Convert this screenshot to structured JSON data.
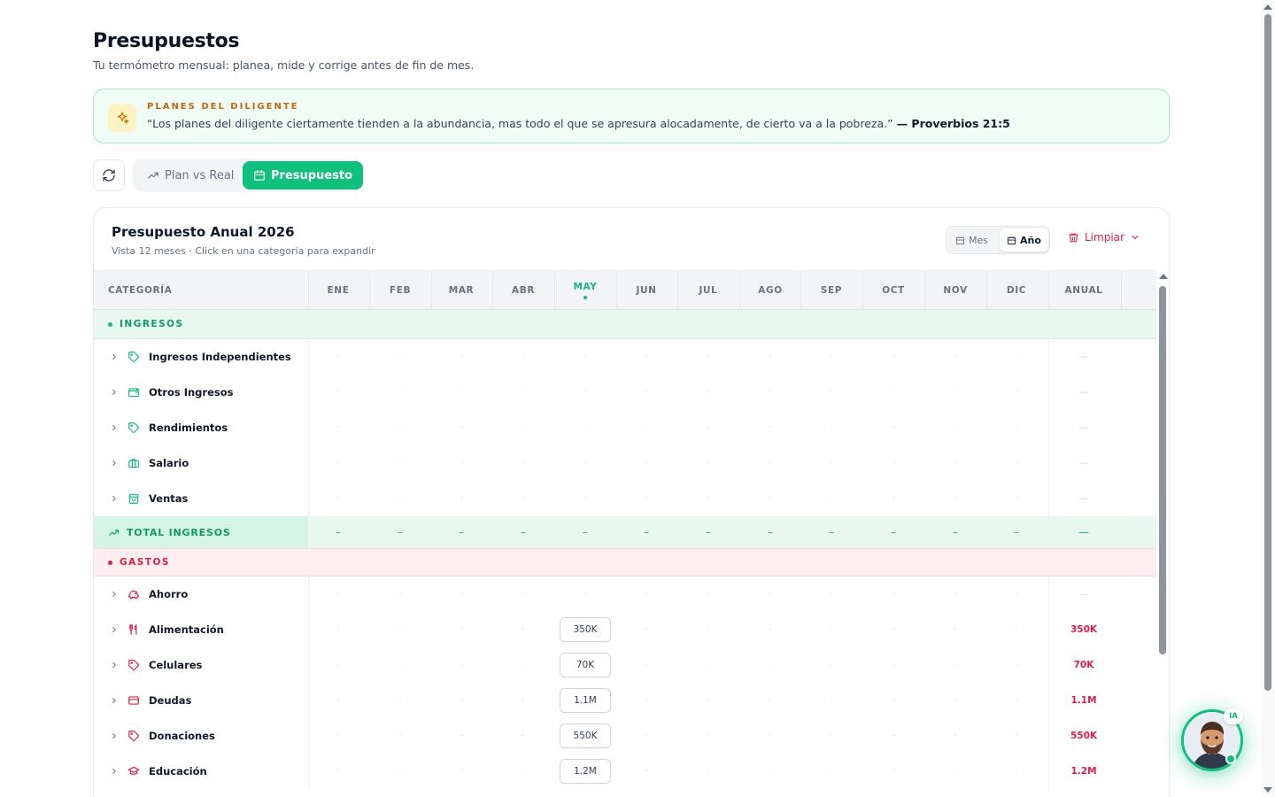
{
  "header": {
    "title": "Presupuestos",
    "subtitle": "Tu termómetro mensual: planea, mide y corrige antes de fin de mes."
  },
  "quote": {
    "heading": "PLANES DEL DILIGENTE",
    "text": "“Los planes del diligente ciertamente tienden a la abundancia, mas todo el que se apresura alocadamente, de cierto va a la pobreza.”",
    "reference": "— Proverbios 21:5",
    "icon": "sparkles-icon"
  },
  "toolbar": {
    "refresh_icon": "refresh-icon",
    "views": [
      {
        "label": "Plan vs Real",
        "icon": "trending-up-icon",
        "active": false
      },
      {
        "label": "Presupuesto",
        "icon": "calendar-icon",
        "active": true
      }
    ]
  },
  "panel": {
    "title": "Presupuesto Anual 2026",
    "subtitle": "Vista 12 meses · Click en una categoría para expandir",
    "range": {
      "mes_label": "Mes",
      "ano_label": "Año",
      "selected": "Año"
    },
    "clear_label": "Limpiar"
  },
  "table": {
    "category_header": "CATEGORÍA",
    "months": [
      "ENE",
      "FEB",
      "MAR",
      "ABR",
      "MAY",
      "JUN",
      "JUL",
      "AGO",
      "SEP",
      "OCT",
      "NOV",
      "DIC"
    ],
    "current_month": "MAY",
    "annual_header": "ANUAL",
    "empty_cell": "·",
    "empty_annual": "—",
    "income_section": "INGRESOS",
    "income_rows": [
      {
        "name": "Ingresos Independientes",
        "icon": "tag-icon"
      },
      {
        "name": "Otros Ingresos",
        "icon": "wallet-icon"
      },
      {
        "name": "Rendimientos",
        "icon": "tag-icon"
      },
      {
        "name": "Salario",
        "icon": "briefcase-icon"
      },
      {
        "name": "Ventas",
        "icon": "shopping-bag-icon"
      }
    ],
    "total_income_label": "TOTAL INGRESOS",
    "total_income_cell": "–",
    "total_income_annual": "—",
    "expense_section": "GASTOS",
    "expense_rows": [
      {
        "name": "Ahorro",
        "icon": "piggy-bank-icon",
        "may": "",
        "annual": ""
      },
      {
        "name": "Alimentación",
        "icon": "utensils-icon",
        "may": "350K",
        "annual": "350K"
      },
      {
        "name": "Celulares",
        "icon": "tag-icon",
        "may": "70K",
        "annual": "70K"
      },
      {
        "name": "Deudas",
        "icon": "credit-card-icon",
        "may": "1.1M",
        "annual": "1.1M"
      },
      {
        "name": "Donaciones",
        "icon": "tag-icon",
        "may": "550K",
        "annual": "550K"
      },
      {
        "name": "Educación",
        "icon": "graduation-cap-icon",
        "may": "1.2M",
        "annual": "1.2M"
      }
    ]
  },
  "assistant": {
    "badge": "IA",
    "icon": "assistant-avatar-icon"
  },
  "colors": {
    "accent": "#10c07e",
    "income": "#0b9b68",
    "expense": "#e11d48",
    "quote_heading": "#c2680c"
  }
}
